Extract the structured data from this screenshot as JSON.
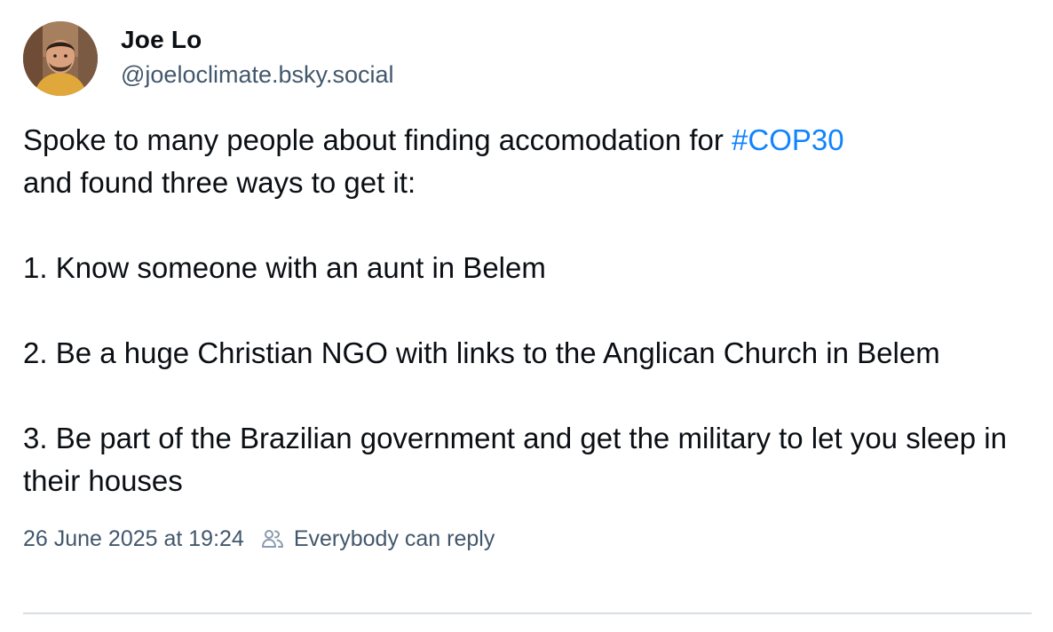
{
  "author": {
    "display_name": "Joe Lo",
    "handle": "@joeloclimate.bsky.social"
  },
  "post": {
    "line1_text": "Spoke to many people about finding accomodation for ",
    "hashtag": "#COP30",
    "line1_tail": "and found three ways to get it:",
    "item1": "1. Know someone with an aunt in Belem",
    "item2": "2. Be a huge Christian NGO with links to the Anglican Church in Belem",
    "item3": "3. Be part of the Brazilian government and get the military to let you sleep in their houses"
  },
  "meta": {
    "timestamp": "26 June 2025 at 19:24",
    "reply_setting_icon": "people-icon",
    "reply_setting": "Everybody can reply"
  },
  "colors": {
    "text": "#0b0f14",
    "secondary": "#42576c",
    "link": "#1083fe",
    "divider": "#d9dee4"
  }
}
